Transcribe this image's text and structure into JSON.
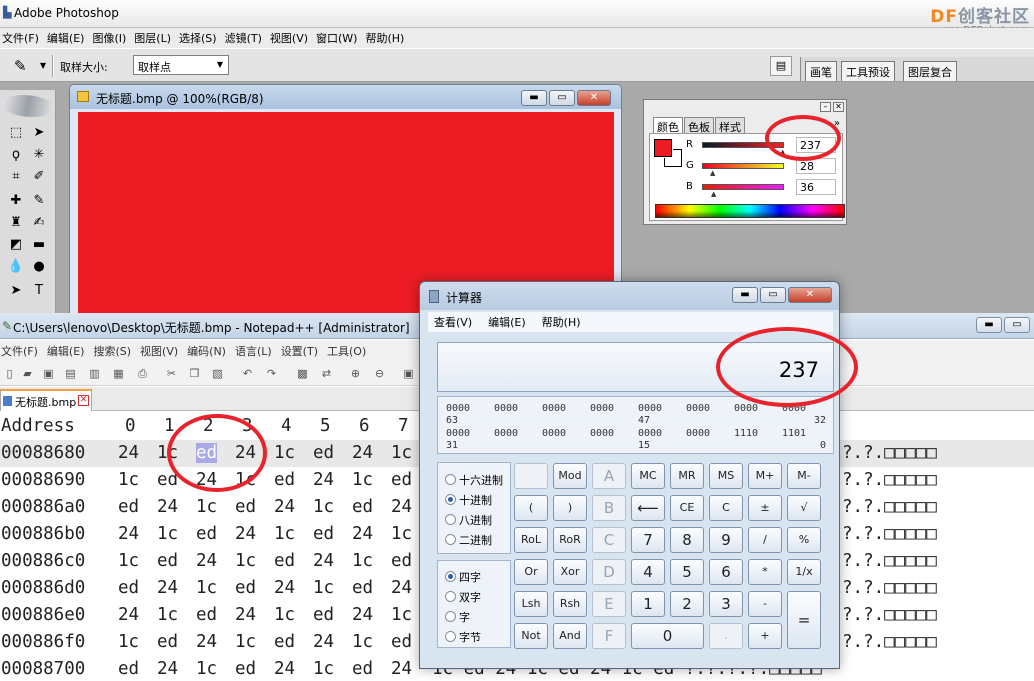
{
  "photoshop": {
    "title": "Adobe Photoshop",
    "watermark": {
      "brand_left": "DF",
      "brand_right": "创客社区",
      "url": "mc.DFRobot.com"
    },
    "menu": [
      "文件(F)",
      "编辑(E)",
      "图像(I)",
      "图层(L)",
      "选择(S)",
      "滤镜(T)",
      "视图(V)",
      "窗口(W)",
      "帮助(H)"
    ],
    "options": {
      "sample_size_label": "取样大小:",
      "sample_size_value": "取样点"
    },
    "palette_well_tabs": [
      "画笔",
      "工具预设",
      "图层复合"
    ],
    "document": {
      "title": "无标题.bmp @ 100%(RGB/8)",
      "canvas_color": "#ed1c24"
    },
    "color_panel": {
      "tabs": [
        "颜色",
        "色板",
        "样式"
      ],
      "r_label": "R",
      "g_label": "G",
      "b_label": "B",
      "r": "237",
      "g": "28",
      "b": "36"
    }
  },
  "notepad": {
    "title": "C:\\Users\\lenovo\\Desktop\\无标题.bmp - Notepad++ [Administrator]",
    "menu": [
      "文件(F)",
      "编辑(E)",
      "搜索(S)",
      "视图(V)",
      "编码(N)",
      "语言(L)",
      "设置(T)",
      "工具(O)"
    ],
    "tab": "无标题.bmp",
    "hex": {
      "header_label": "Address",
      "header_cols": [
        "0",
        "1",
        "2",
        "3",
        "4",
        "5",
        "6",
        "7"
      ],
      "rows": [
        {
          "addr": "00088680",
          "bytes": [
            "24",
            "1c",
            "ed",
            "24",
            "1c",
            "ed",
            "24",
            "1c"
          ],
          "ascii": "?.?.□□□□□"
        },
        {
          "addr": "00088690",
          "bytes": [
            "1c",
            "ed",
            "24",
            "1c",
            "ed",
            "24",
            "1c",
            "ed"
          ],
          "ascii": "?.?.□□□□□"
        },
        {
          "addr": "000886a0",
          "bytes": [
            "ed",
            "24",
            "1c",
            "ed",
            "24",
            "1c",
            "ed",
            "24"
          ],
          "ascii": "?.?.□□□□□"
        },
        {
          "addr": "000886b0",
          "bytes": [
            "24",
            "1c",
            "ed",
            "24",
            "1c",
            "ed",
            "24",
            "1c"
          ],
          "ascii": "?.?.□□□□□"
        },
        {
          "addr": "000886c0",
          "bytes": [
            "1c",
            "ed",
            "24",
            "1c",
            "ed",
            "24",
            "1c",
            "ed"
          ],
          "ascii": "?.?.□□□□□"
        },
        {
          "addr": "000886d0",
          "bytes": [
            "ed",
            "24",
            "1c",
            "ed",
            "24",
            "1c",
            "ed",
            "24"
          ],
          "ascii": "?.?.□□□□□"
        },
        {
          "addr": "000886e0",
          "bytes": [
            "24",
            "1c",
            "ed",
            "24",
            "1c",
            "ed",
            "24",
            "1c"
          ],
          "ascii": "?.?.□□□□□"
        },
        {
          "addr": "000886f0",
          "bytes": [
            "1c",
            "ed",
            "24",
            "1c",
            "ed",
            "24",
            "1c",
            "ed"
          ],
          "ascii": "?.?.□□□□□"
        },
        {
          "addr": "00088700",
          "bytes": [
            "ed",
            "24",
            "1c",
            "ed",
            "24",
            "1c",
            "ed",
            "24"
          ],
          "ascii": "1c ed 24 1c ed 24 1c ed ?.?.?.?.□□□□□"
        }
      ],
      "selected": {
        "row": 0,
        "col": 2
      }
    }
  },
  "calculator": {
    "title": "计算器",
    "menu": [
      "查看(V)",
      "编辑(E)",
      "帮助(H)"
    ],
    "display": "237",
    "bits_row1": [
      "0000",
      "0000",
      "0000",
      "0000",
      "0000",
      "0000",
      "0000",
      "0000"
    ],
    "bits_row1_idx": [
      "63",
      "47",
      "32"
    ],
    "bits_row2": [
      "0000",
      "0000",
      "0000",
      "0000",
      "0000",
      "0000",
      "1110",
      "1101"
    ],
    "bits_row2_idx": [
      "31",
      "15",
      "0"
    ],
    "base_modes": [
      "十六进制",
      "十进制",
      "八进制",
      "二进制"
    ],
    "word_modes": [
      "四字",
      "双字",
      "字",
      "字节"
    ],
    "keys": {
      "mod": "Mod",
      "a": "A",
      "mc": "MC",
      "mr": "MR",
      "ms": "MS",
      "mplus": "M+",
      "mminus": "M-",
      "lparen": "(",
      "rparen": ")",
      "b": "B",
      "back": "⟵",
      "ce": "CE",
      "c": "C",
      "pm": "±",
      "sqrt": "√",
      "rol": "RoL",
      "ror": "RoR",
      "c_hex": "C",
      "n7": "7",
      "n8": "8",
      "n9": "9",
      "div": "/",
      "pct": "%",
      "or": "Or",
      "xor": "Xor",
      "d": "D",
      "n4": "4",
      "n5": "5",
      "n6": "6",
      "mul": "*",
      "inv": "1/x",
      "lsh": "Lsh",
      "rsh": "Rsh",
      "e": "E",
      "n1": "1",
      "n2": "2",
      "n3": "3",
      "sub": "-",
      "not": "Not",
      "and": "And",
      "f": "F",
      "n0": "0",
      "dot": ".",
      "add": "+",
      "eq": "="
    }
  }
}
